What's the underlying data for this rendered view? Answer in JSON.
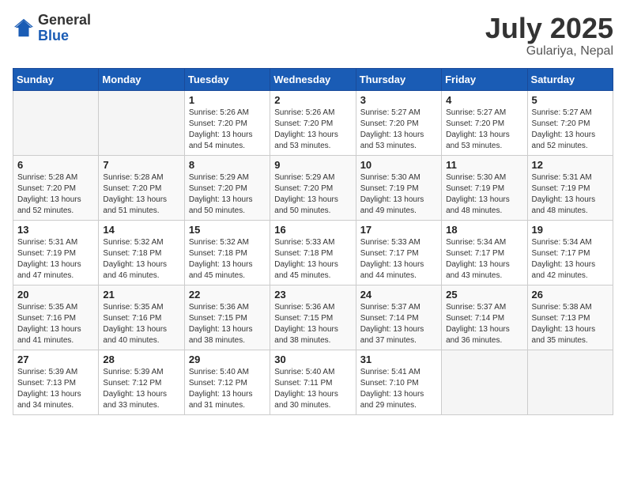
{
  "logo": {
    "general": "General",
    "blue": "Blue"
  },
  "title": {
    "month_year": "July 2025",
    "location": "Gulariya, Nepal"
  },
  "weekdays": [
    "Sunday",
    "Monday",
    "Tuesday",
    "Wednesday",
    "Thursday",
    "Friday",
    "Saturday"
  ],
  "weeks": [
    [
      {
        "day": "",
        "info": ""
      },
      {
        "day": "",
        "info": ""
      },
      {
        "day": "1",
        "info": "Sunrise: 5:26 AM\nSunset: 7:20 PM\nDaylight: 13 hours and 54 minutes."
      },
      {
        "day": "2",
        "info": "Sunrise: 5:26 AM\nSunset: 7:20 PM\nDaylight: 13 hours and 53 minutes."
      },
      {
        "day": "3",
        "info": "Sunrise: 5:27 AM\nSunset: 7:20 PM\nDaylight: 13 hours and 53 minutes."
      },
      {
        "day": "4",
        "info": "Sunrise: 5:27 AM\nSunset: 7:20 PM\nDaylight: 13 hours and 53 minutes."
      },
      {
        "day": "5",
        "info": "Sunrise: 5:27 AM\nSunset: 7:20 PM\nDaylight: 13 hours and 52 minutes."
      }
    ],
    [
      {
        "day": "6",
        "info": "Sunrise: 5:28 AM\nSunset: 7:20 PM\nDaylight: 13 hours and 52 minutes."
      },
      {
        "day": "7",
        "info": "Sunrise: 5:28 AM\nSunset: 7:20 PM\nDaylight: 13 hours and 51 minutes."
      },
      {
        "day": "8",
        "info": "Sunrise: 5:29 AM\nSunset: 7:20 PM\nDaylight: 13 hours and 50 minutes."
      },
      {
        "day": "9",
        "info": "Sunrise: 5:29 AM\nSunset: 7:20 PM\nDaylight: 13 hours and 50 minutes."
      },
      {
        "day": "10",
        "info": "Sunrise: 5:30 AM\nSunset: 7:19 PM\nDaylight: 13 hours and 49 minutes."
      },
      {
        "day": "11",
        "info": "Sunrise: 5:30 AM\nSunset: 7:19 PM\nDaylight: 13 hours and 48 minutes."
      },
      {
        "day": "12",
        "info": "Sunrise: 5:31 AM\nSunset: 7:19 PM\nDaylight: 13 hours and 48 minutes."
      }
    ],
    [
      {
        "day": "13",
        "info": "Sunrise: 5:31 AM\nSunset: 7:19 PM\nDaylight: 13 hours and 47 minutes."
      },
      {
        "day": "14",
        "info": "Sunrise: 5:32 AM\nSunset: 7:18 PM\nDaylight: 13 hours and 46 minutes."
      },
      {
        "day": "15",
        "info": "Sunrise: 5:32 AM\nSunset: 7:18 PM\nDaylight: 13 hours and 45 minutes."
      },
      {
        "day": "16",
        "info": "Sunrise: 5:33 AM\nSunset: 7:18 PM\nDaylight: 13 hours and 45 minutes."
      },
      {
        "day": "17",
        "info": "Sunrise: 5:33 AM\nSunset: 7:17 PM\nDaylight: 13 hours and 44 minutes."
      },
      {
        "day": "18",
        "info": "Sunrise: 5:34 AM\nSunset: 7:17 PM\nDaylight: 13 hours and 43 minutes."
      },
      {
        "day": "19",
        "info": "Sunrise: 5:34 AM\nSunset: 7:17 PM\nDaylight: 13 hours and 42 minutes."
      }
    ],
    [
      {
        "day": "20",
        "info": "Sunrise: 5:35 AM\nSunset: 7:16 PM\nDaylight: 13 hours and 41 minutes."
      },
      {
        "day": "21",
        "info": "Sunrise: 5:35 AM\nSunset: 7:16 PM\nDaylight: 13 hours and 40 minutes."
      },
      {
        "day": "22",
        "info": "Sunrise: 5:36 AM\nSunset: 7:15 PM\nDaylight: 13 hours and 38 minutes."
      },
      {
        "day": "23",
        "info": "Sunrise: 5:36 AM\nSunset: 7:15 PM\nDaylight: 13 hours and 38 minutes."
      },
      {
        "day": "24",
        "info": "Sunrise: 5:37 AM\nSunset: 7:14 PM\nDaylight: 13 hours and 37 minutes."
      },
      {
        "day": "25",
        "info": "Sunrise: 5:37 AM\nSunset: 7:14 PM\nDaylight: 13 hours and 36 minutes."
      },
      {
        "day": "26",
        "info": "Sunrise: 5:38 AM\nSunset: 7:13 PM\nDaylight: 13 hours and 35 minutes."
      }
    ],
    [
      {
        "day": "27",
        "info": "Sunrise: 5:39 AM\nSunset: 7:13 PM\nDaylight: 13 hours and 34 minutes."
      },
      {
        "day": "28",
        "info": "Sunrise: 5:39 AM\nSunset: 7:12 PM\nDaylight: 13 hours and 33 minutes."
      },
      {
        "day": "29",
        "info": "Sunrise: 5:40 AM\nSunset: 7:12 PM\nDaylight: 13 hours and 31 minutes."
      },
      {
        "day": "30",
        "info": "Sunrise: 5:40 AM\nSunset: 7:11 PM\nDaylight: 13 hours and 30 minutes."
      },
      {
        "day": "31",
        "info": "Sunrise: 5:41 AM\nSunset: 7:10 PM\nDaylight: 13 hours and 29 minutes."
      },
      {
        "day": "",
        "info": ""
      },
      {
        "day": "",
        "info": ""
      }
    ]
  ]
}
